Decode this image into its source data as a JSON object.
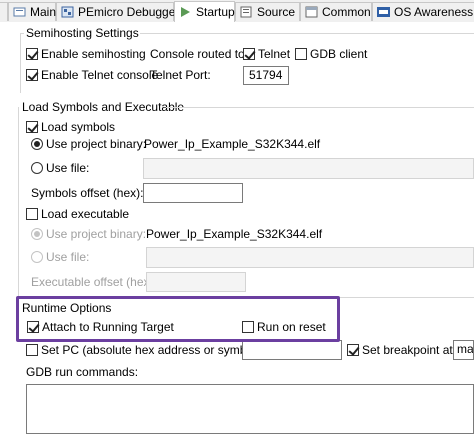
{
  "tabs": [
    {
      "label": "Main",
      "icon": "main-tab-icon"
    },
    {
      "label": "PEmicro Debugger",
      "icon": "debugger-icon"
    },
    {
      "label": "Startup",
      "icon": "startup-play-icon"
    },
    {
      "label": "Source",
      "icon": "source-icon"
    },
    {
      "label": "Common",
      "icon": "common-icon"
    },
    {
      "label": "OS Awareness",
      "icon": "os-awareness-icon"
    }
  ],
  "semihosting": {
    "group_label": "Semihosting Settings",
    "enable_semihosting": {
      "label": "Enable semihosting",
      "checked": true
    },
    "enable_telnet": {
      "label": "Enable Telnet console",
      "checked": true
    },
    "console_routed_label": "Console routed to:",
    "telnet": {
      "label": "Telnet",
      "checked": true
    },
    "gdb_client": {
      "label": "GDB client",
      "checked": false
    },
    "telnet_port_label": "Telnet Port:",
    "telnet_port_value": "51794"
  },
  "load_symbols_exec": {
    "group_label": "Load Symbols and Executable",
    "load_symbols": {
      "label": "Load symbols",
      "checked": true
    },
    "use_project_binary_label": "Use project binary:",
    "project_binary_value": "Power_Ip_Example_S32K344.elf",
    "use_file_label": "Use file:",
    "symbols_offset_label": "Symbols offset (hex):",
    "load_executable": {
      "label": "Load executable",
      "checked": false
    },
    "exec_use_project_binary_label": "Use project binary:",
    "exec_project_binary_value": "Power_Ip_Example_S32K344.elf",
    "exec_use_file_label": "Use file:",
    "executable_offset_label": "Executable offset (hex):"
  },
  "runtime": {
    "group_label": "Runtime Options",
    "attach": {
      "label": "Attach to Running Target",
      "checked": true
    },
    "run_on_reset": {
      "label": "Run on reset",
      "checked": false
    },
    "set_pc": {
      "label": "Set PC (absolute hex address or symbol):",
      "checked": false
    },
    "set_breakpoint": {
      "label": "Set breakpoint at:",
      "checked": true
    },
    "breakpoint_value": "ma",
    "gdb_run_commands_label": "GDB run commands:"
  },
  "colors": {
    "highlight": "#6b3fa0"
  }
}
